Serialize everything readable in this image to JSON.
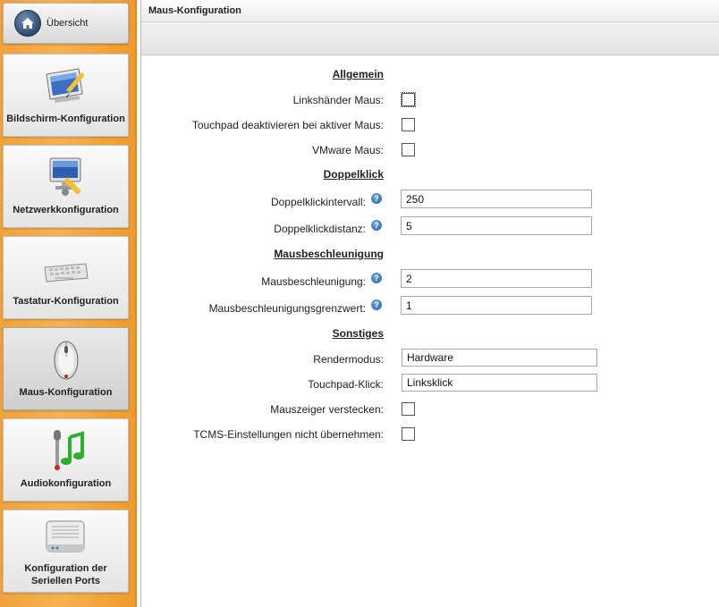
{
  "home": {
    "label": "Übersicht",
    "icon": "home-icon"
  },
  "sidebar": {
    "items": [
      {
        "label": "Bildschirm-Konfiguration",
        "icon": "display-config-icon"
      },
      {
        "label": "Netzwerkkonfiguration",
        "icon": "network-config-icon"
      },
      {
        "label": "Tastatur-Konfiguration",
        "icon": "keyboard-icon"
      },
      {
        "label": "Maus-Konfiguration",
        "icon": "mouse-icon"
      },
      {
        "label": "Audiokonfiguration",
        "icon": "audio-icon"
      },
      {
        "label": "Konfiguration der Seriellen Ports",
        "icon": "serial-port-icon"
      }
    ]
  },
  "window": {
    "title": "Maus-Konfiguration"
  },
  "sections": {
    "general": "Allgemein",
    "doubleclick": "Doppelklick",
    "acceleration": "Mausbeschleunigung",
    "other": "Sonstiges"
  },
  "fields": {
    "left_handed": {
      "label": "Linkshänder Maus:",
      "checked": false
    },
    "touchpad_disable": {
      "label": "Touchpad deaktivieren bei aktiver Maus:",
      "checked": false
    },
    "vmware_mouse": {
      "label": "VMware Maus:",
      "checked": false
    },
    "dbl_interval": {
      "label": "Doppelklickintervall:",
      "value": "250"
    },
    "dbl_distance": {
      "label": "Doppelklickdistanz:",
      "value": "5"
    },
    "accel": {
      "label": "Mausbeschleunigung:",
      "value": "2"
    },
    "accel_threshold": {
      "label": "Mausbeschleunigungsgrenzwert:",
      "value": "1"
    },
    "render_mode": {
      "label": "Rendermodus:",
      "value": "Hardware"
    },
    "touchpad_click": {
      "label": "Touchpad-Klick:",
      "value": "Linksklick"
    },
    "hide_pointer": {
      "label": "Mauszeiger verstecken:",
      "checked": false
    },
    "tcms_ignore": {
      "label": "TCMS-Einstellungen nicht übernehmen:",
      "checked": false
    }
  },
  "help_glyph": "?",
  "colors": {
    "sidebar_orange": "#f0a23c",
    "help_blue": "#1f5fb4",
    "home_blue": "#2f4c70"
  }
}
